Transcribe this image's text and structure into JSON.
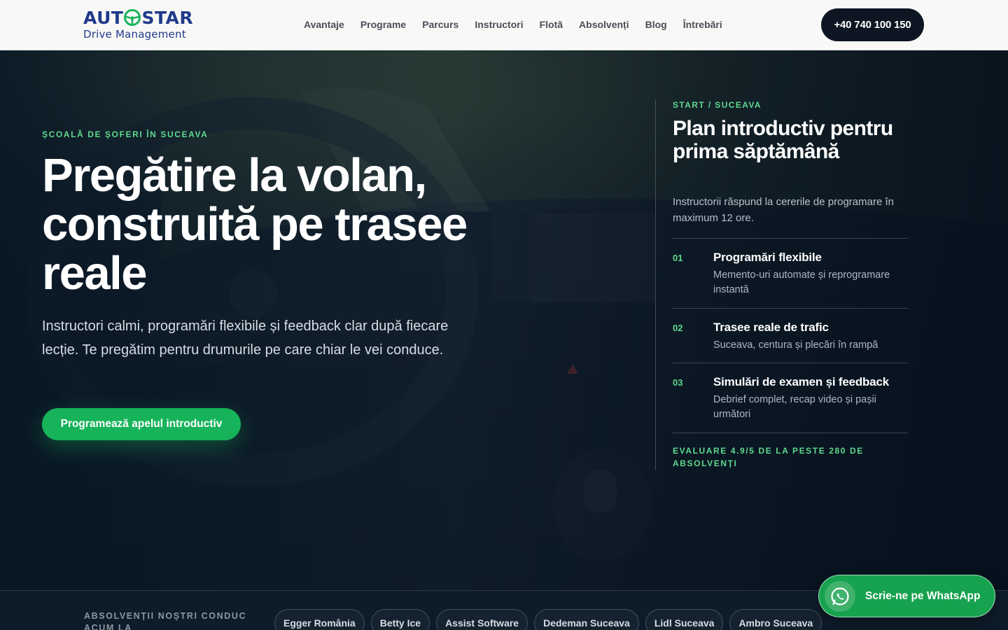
{
  "brand": {
    "logo_top_left": "AUT",
    "logo_top_right": "STAR",
    "logo_sub": "Drive Management",
    "colors": {
      "brand_blue": "#1f3a8a",
      "accent_green": "#17b35a",
      "eyebrow_green": "#5fd98f",
      "dark": "#0d1622"
    }
  },
  "nav": {
    "items": [
      "Avantaje",
      "Programe",
      "Parcurs",
      "Instructori",
      "Flotă",
      "Absolvenți",
      "Blog",
      "Întrebări"
    ],
    "phone": "+40 740 100 150"
  },
  "hero": {
    "eyebrow": "ȘCOALĂ DE ȘOFERI ÎN SUCEAVA",
    "title": "Pregătire la volan, construită pe trasee reale",
    "description": "Instructori calmi, programări flexibile și feedback clar după fiecare lecție. Te pregătim pentru drumurile pe care chiar le vei conduce.",
    "cta": "Programează apelul introductiv"
  },
  "panel": {
    "eyebrow": "START / SUCEAVA",
    "title": "Plan introductiv pentru prima săptămână",
    "description": "Instructorii răspund la cererile de programare în maximum 12 ore.",
    "steps": [
      {
        "num": "01",
        "title": "Programări flexibile",
        "desc": "Memento-uri automate și reprogramare instantă"
      },
      {
        "num": "02",
        "title": "Trasee reale de trafic",
        "desc": "Suceava, centura și plecări în rampă"
      },
      {
        "num": "03",
        "title": "Simulări de examen și feedback",
        "desc": "Debrief complet, recap video și pașii următori"
      }
    ],
    "footer": "EVALUARE 4.9/5 DE LA PESTE 280 DE ABSOLVENȚI"
  },
  "strip": {
    "label": "ABSOLVENȚII NOȘTRI CONDUC ACUM LA",
    "companies": [
      "Egger România",
      "Betty Ice",
      "Assist Software",
      "Dedeman Suceava",
      "Lidl Suceava",
      "Ambro Suceava"
    ]
  },
  "whatsapp": {
    "label": "Scrie-ne pe WhatsApp",
    "icon": "whatsapp-icon"
  }
}
